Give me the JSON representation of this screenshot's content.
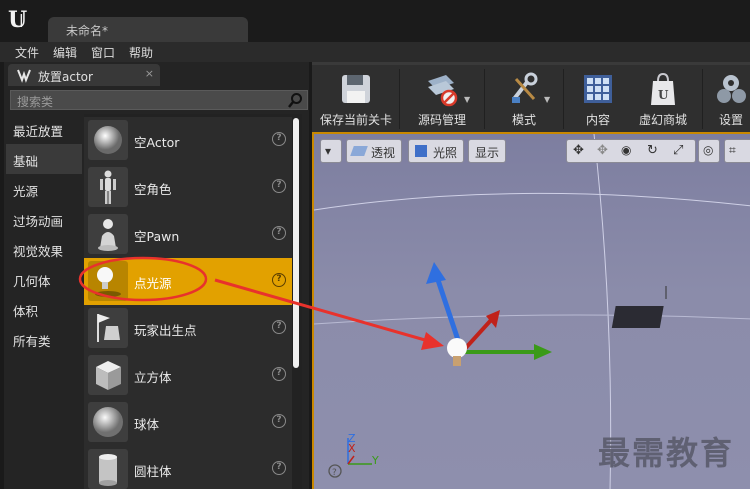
{
  "window": {
    "doc_tab": "未命名*"
  },
  "menu": [
    "文件",
    "编辑",
    "窗口",
    "帮助"
  ],
  "panel": {
    "title": "放置actor",
    "close": "×",
    "search_placeholder": "搜索类",
    "categories": [
      {
        "label": "最近放置",
        "active": false
      },
      {
        "label": "基础",
        "active": true
      },
      {
        "label": "光源",
        "active": false
      },
      {
        "label": "过场动画",
        "active": false
      },
      {
        "label": "视觉效果",
        "active": false
      },
      {
        "label": "几何体",
        "active": false
      },
      {
        "label": "体积",
        "active": false
      },
      {
        "label": "所有类",
        "active": false
      }
    ],
    "items": [
      {
        "label": "空Actor",
        "icon": "sphere-icon",
        "selected": false
      },
      {
        "label": "空角色",
        "icon": "character-icon",
        "selected": false
      },
      {
        "label": "空Pawn",
        "icon": "pawn-icon",
        "selected": false
      },
      {
        "label": "点光源",
        "icon": "light-bulb-icon",
        "selected": true
      },
      {
        "label": "玩家出生点",
        "icon": "player-start-icon",
        "selected": false
      },
      {
        "label": "立方体",
        "icon": "cube-icon",
        "selected": false
      },
      {
        "label": "球体",
        "icon": "sphere-icon",
        "selected": false
      },
      {
        "label": "圆柱体",
        "icon": "cylinder-icon",
        "selected": false
      }
    ],
    "help_glyph": "?"
  },
  "toolbar": {
    "buttons": [
      {
        "label": "保存当前关卡",
        "icon": "save-disk-icon"
      },
      {
        "label": "源码管理",
        "icon": "source-control-icon"
      },
      {
        "label": "模式",
        "icon": "modes-tools-icon"
      },
      {
        "label": "内容",
        "icon": "content-grid-icon"
      },
      {
        "label": "虚幻商城",
        "icon": "marketplace-bag-icon"
      },
      {
        "label": "设置",
        "icon": "settings-gears-icon"
      }
    ]
  },
  "viewport": {
    "perspective": "透视",
    "lit": "光照",
    "show": "显示",
    "axis": {
      "z": "Z",
      "x": "X",
      "y": "Y"
    }
  },
  "watermark": "最需教育",
  "colors": {
    "selection": "#e2a100",
    "viewport_border": "#c98800",
    "annotation": "#e8322c"
  }
}
